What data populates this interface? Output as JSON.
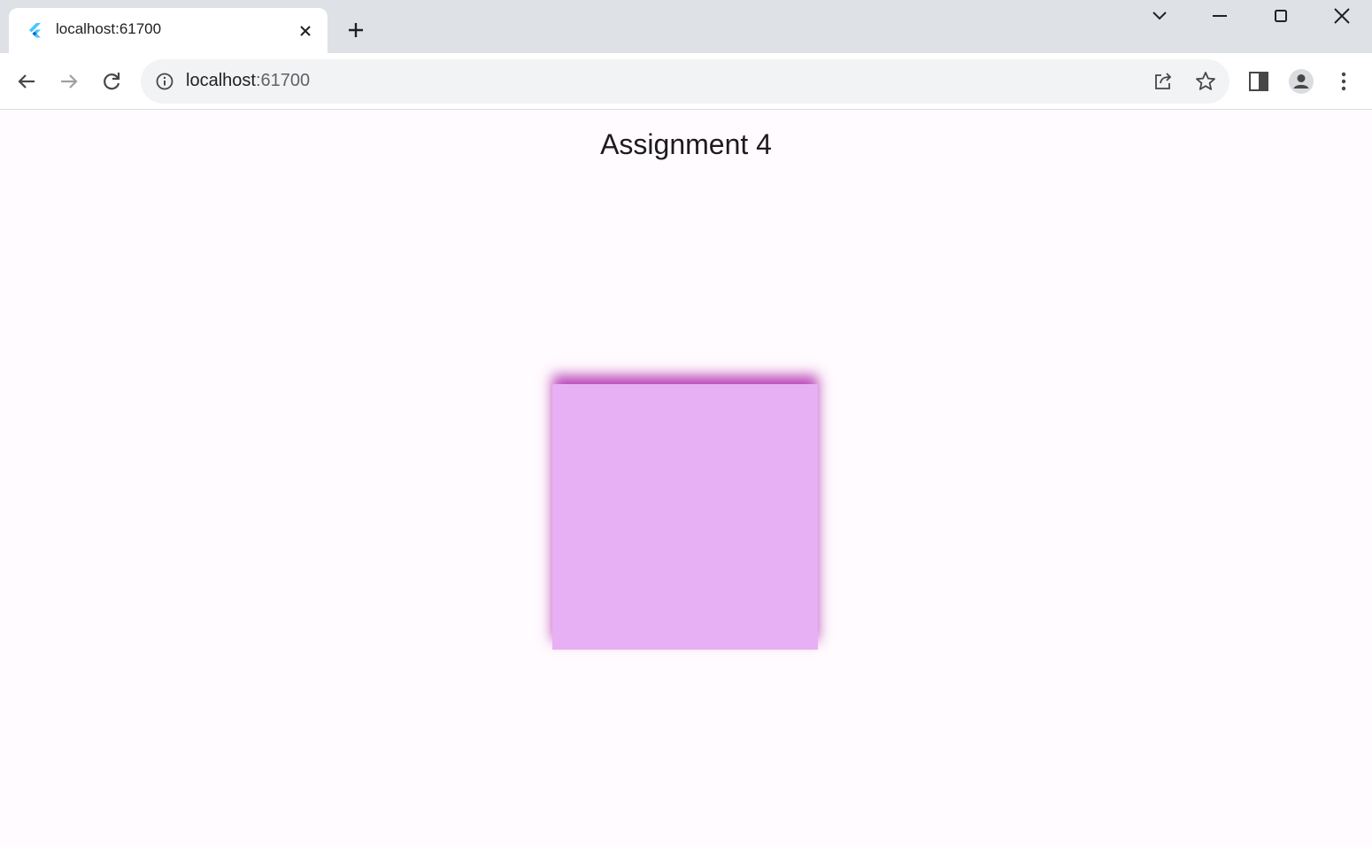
{
  "browser": {
    "tab": {
      "title": "localhost:61700",
      "favicon": "flutter-logo-icon"
    },
    "new_tab_icon": "plus-icon",
    "window_controls": [
      "chevron-down-icon",
      "minimize-icon",
      "maximize-icon",
      "close-icon"
    ],
    "address_bar": {
      "host": "localhost",
      "port": ":61700",
      "info_icon": "info-icon"
    },
    "toolbar_icons": [
      "back-arrow-icon",
      "forward-arrow-icon",
      "reload-icon",
      "share-icon",
      "star-icon",
      "side-panel-icon",
      "profile-icon",
      "more-vert-icon"
    ]
  },
  "page": {
    "title": "Assignment 4",
    "box_color": "#e8b0f4",
    "shadow_color": "#ae28aa",
    "background": "#fffbfe"
  }
}
